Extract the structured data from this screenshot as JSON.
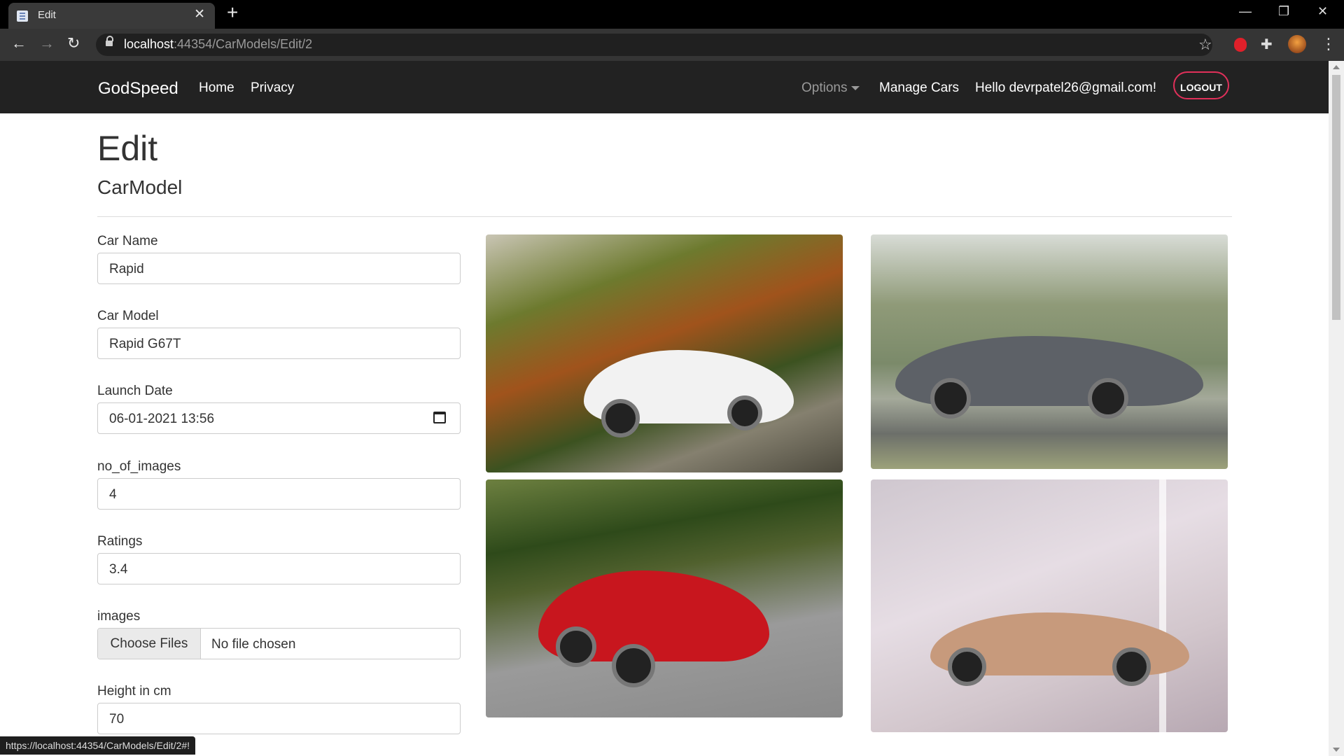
{
  "browser": {
    "tab_title": "Edit",
    "url_host": "localhost",
    "url_rest": ":44354/CarModels/Edit/2",
    "status_url": "https://localhost:44354/CarModels/Edit/2#!"
  },
  "navbar": {
    "brand": "GodSpeed",
    "links": [
      "Home",
      "Privacy"
    ],
    "options_label": "Options",
    "manage_label": "Manage Cars",
    "hello_text": "Hello devrpatel26@gmail.com!",
    "logout_label": "LOGOUT"
  },
  "page": {
    "title": "Edit",
    "subtitle": "CarModel"
  },
  "form": {
    "car_name": {
      "label": "Car Name",
      "value": "Rapid"
    },
    "car_model": {
      "label": "Car Model",
      "value": "Rapid G67T"
    },
    "launch_date": {
      "label": "Launch Date",
      "value": "06-01-2021 13:56"
    },
    "no_of_images": {
      "label": "no_of_images",
      "value": "4"
    },
    "ratings": {
      "label": "Ratings",
      "value": "3.4"
    },
    "images": {
      "label": "images",
      "button": "Choose Files",
      "status": "No file chosen"
    },
    "height": {
      "label": "Height in cm",
      "value": "70"
    }
  },
  "images": [
    {
      "alt": "white-sedan-photo",
      "car_color": "#f2f2f2"
    },
    {
      "alt": "gray-sedan-photo",
      "car_color": "#5d6167"
    },
    {
      "alt": "red-sedan-photo",
      "car_color": "#c8161e"
    },
    {
      "alt": "bronze-coupe-photo",
      "car_color": "#c79a7c"
    }
  ],
  "colors": {
    "navbar_bg": "#222222",
    "logout_border": "#e0305a"
  }
}
